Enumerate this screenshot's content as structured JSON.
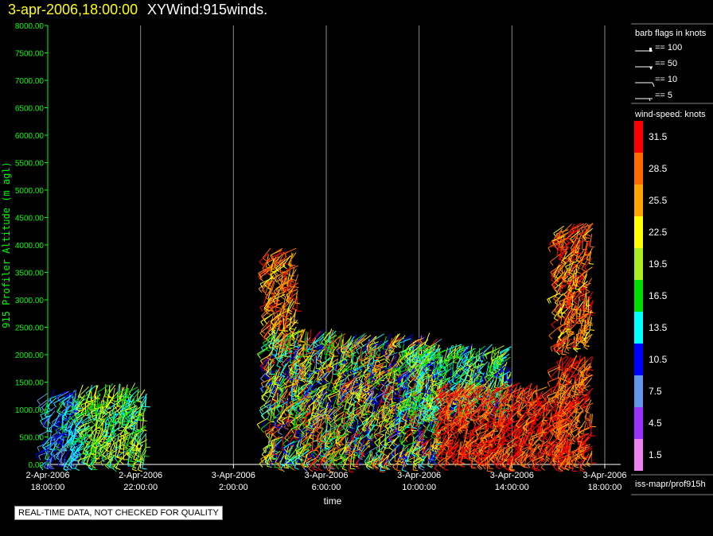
{
  "header": {
    "datetime": "3-apr-2006,18:00:00",
    "title": "XYWind:915winds."
  },
  "notice": "REAL-TIME DATA, NOT CHECKED FOR QUALITY",
  "legend": {
    "barb_title": "barb flags in knots",
    "barbs": [
      {
        "label": "== 100",
        "type": "flag100"
      },
      {
        "label": "== 50",
        "type": "flag50"
      },
      {
        "label": "== 10",
        "type": "barb10"
      },
      {
        "label": "== 5",
        "type": "barb5"
      }
    ],
    "colorbar_title": "wind-speed: knots",
    "colorbar": [
      {
        "label": "31.5",
        "color": "#ff0000"
      },
      {
        "label": "28.5",
        "color": "#ff6a00"
      },
      {
        "label": "25.5",
        "color": "#ffa500"
      },
      {
        "label": "22.5",
        "color": "#ffff00"
      },
      {
        "label": "19.5",
        "color": "#aaee22"
      },
      {
        "label": "16.5",
        "color": "#00dd00"
      },
      {
        "label": "13.5",
        "color": "#00ffff"
      },
      {
        "label": "10.5",
        "color": "#0000ff"
      },
      {
        "label": "7.5",
        "color": "#6495ed"
      },
      {
        "label": "4.5",
        "color": "#9b30ff"
      },
      {
        "label": "1.5",
        "color": "#ee82ee"
      }
    ],
    "source": "iss-mapr/prof915h"
  },
  "chart_data": {
    "type": "wind-barb",
    "xlabel": "time",
    "ylabel": "915 Profiler Altitude (m agl)",
    "xticks": [
      [
        "2-Apr-2006",
        "18:00:00"
      ],
      [
        "2-Apr-2006",
        "22:00:00"
      ],
      [
        "3-Apr-2006",
        "2:00:00"
      ],
      [
        "3-Apr-2006",
        "6:00:00"
      ],
      [
        "3-Apr-2006",
        "10:00:00"
      ],
      [
        "3-Apr-2006",
        "14:00:00"
      ],
      [
        "3-Apr-2006",
        "18:00:00"
      ]
    ],
    "xlim_hours_from_2apr_18z": [
      0,
      24
    ],
    "yticks": [
      "0.00",
      "500.00",
      "1000.00",
      "1500.00",
      "2000.00",
      "2500.00",
      "3000.00",
      "3500.00",
      "4000.00",
      "4500.00",
      "5000.00",
      "5500.00",
      "6000.00",
      "6500.00",
      "7000.00",
      "7500.00",
      "8000.00"
    ],
    "ylim": [
      0,
      8000
    ],
    "grid": "vertical",
    "regions": [
      {
        "hours": [
          0,
          1.5
        ],
        "alt": [
          100,
          1400
        ],
        "speed": [
          6,
          16
        ]
      },
      {
        "hours": [
          1.5,
          4.3
        ],
        "alt": [
          100,
          1500
        ],
        "speed": [
          12,
          24
        ]
      },
      {
        "hours": [
          9.5,
          10.8
        ],
        "alt": [
          2500,
          3950
        ],
        "speed": [
          22,
          32
        ]
      },
      {
        "hours": [
          9.5,
          12.5
        ],
        "alt": [
          100,
          2500
        ],
        "speed": [
          8,
          32
        ]
      },
      {
        "hours": [
          12.5,
          17
        ],
        "alt": [
          100,
          2400
        ],
        "speed": [
          8,
          32
        ]
      },
      {
        "hours": [
          15.5,
          20
        ],
        "alt": [
          1000,
          2200
        ],
        "speed": [
          10,
          22
        ]
      },
      {
        "hours": [
          17,
          22.5
        ],
        "alt": [
          100,
          1500
        ],
        "speed": [
          26,
          34
        ]
      },
      {
        "hours": [
          22,
          23.5
        ],
        "alt": [
          100,
          2000
        ],
        "speed": [
          24,
          34
        ]
      },
      {
        "hours": [
          22,
          23.5
        ],
        "alt": [
          2200,
          4400
        ],
        "speed": [
          22,
          34
        ]
      }
    ]
  }
}
